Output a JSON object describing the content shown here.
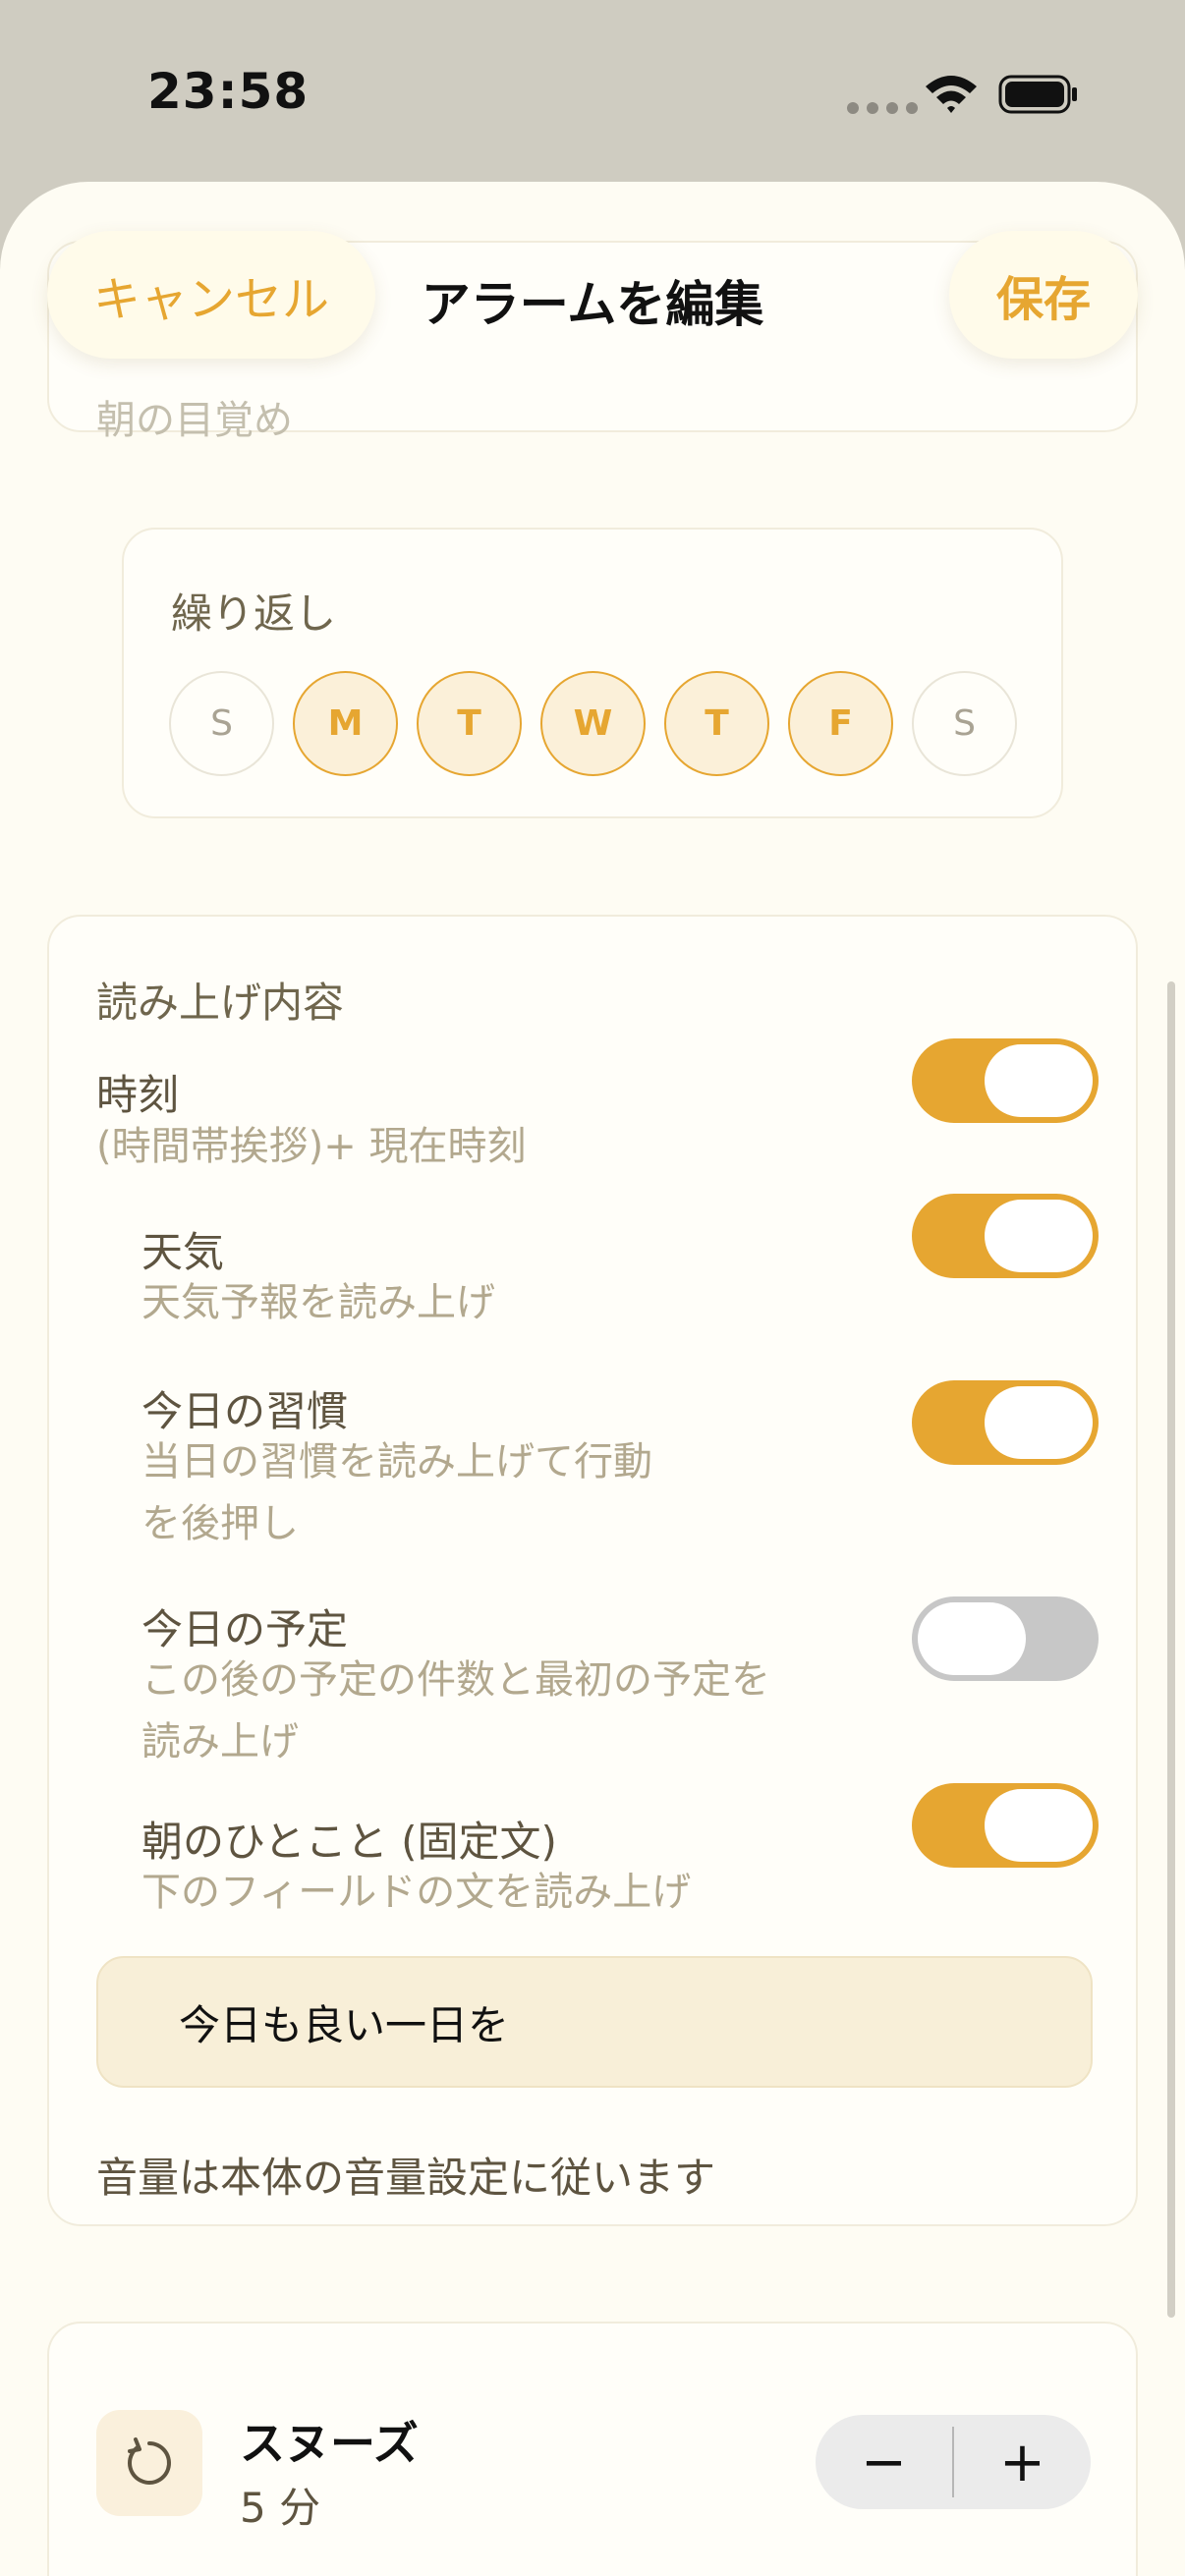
{
  "status_bar": {
    "time": "23:58"
  },
  "header": {
    "cancel_label": "キャンセル",
    "title": "アラームを編集",
    "save_label": "保存"
  },
  "top_card": {
    "partial_text": "朝の目覚め"
  },
  "repeat": {
    "label": "繰り返し",
    "days": [
      {
        "label": "S",
        "selected": false
      },
      {
        "label": "M",
        "selected": true
      },
      {
        "label": "T",
        "selected": true
      },
      {
        "label": "W",
        "selected": true
      },
      {
        "label": "T",
        "selected": true
      },
      {
        "label": "F",
        "selected": true
      },
      {
        "label": "S",
        "selected": false
      }
    ]
  },
  "read_content": {
    "title": "読み上げ内容",
    "items": [
      {
        "title": "時刻",
        "subtitle": "(時間帯挨拶)+ 現在時刻",
        "enabled": true
      },
      {
        "title": "天気",
        "subtitle": "天気予報を読み上げ",
        "enabled": true
      },
      {
        "title": "今日の習慣",
        "subtitle_line1": "当日の習慣を読み上げて行動",
        "subtitle_line2": "を後押し",
        "enabled": true
      },
      {
        "title": "今日の予定",
        "subtitle_line1": "この後の予定の件数と最初の予定を",
        "subtitle_line2": "読み上げ",
        "enabled": false
      },
      {
        "title": "朝のひとこと (固定文)",
        "subtitle": "下のフィールドの文を読み上げ",
        "enabled": true
      }
    ],
    "message_value": "今日も良い一日を",
    "volume_note": "音量は本体の音量設定に従います"
  },
  "snooze": {
    "title": "スヌーズ",
    "value": "5 分",
    "minus_label": "−",
    "plus_label": "+"
  },
  "colors": {
    "accent": "#e6a631",
    "background": "#fefcf3",
    "toggle_off": "#c7c7c7"
  }
}
